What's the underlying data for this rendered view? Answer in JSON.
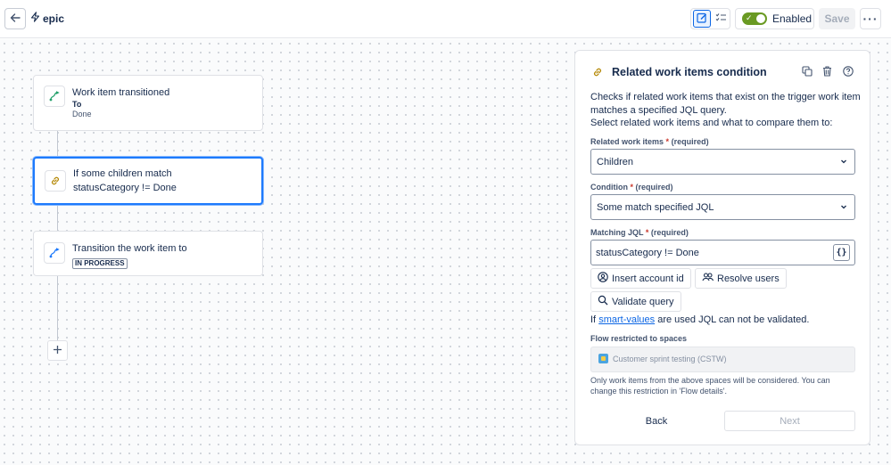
{
  "topbar": {
    "rule_name": "epic",
    "enabled_label": "Enabled",
    "enabled": true,
    "save_label": "Save"
  },
  "flow": {
    "trigger": {
      "title": "Work item transitioned",
      "sub_label": "To",
      "sub_value": "Done"
    },
    "condition": {
      "line1": "If some children match",
      "line2": "statusCategory != Done"
    },
    "action": {
      "title": "Transition the work item to",
      "status": "IN PROGRESS"
    }
  },
  "panel": {
    "title": "Related work items condition",
    "description_line1": "Checks if related work items that exist on the trigger work item matches a specified JQL query.",
    "description_line2": "Select related work items and what to compare them to:",
    "related_label": "Related work items",
    "related_required": "(required)",
    "related_value": "Children",
    "condition_label": "Condition",
    "condition_required": "(required)",
    "condition_value": "Some match specified JQL",
    "jql_label": "Matching JQL",
    "jql_required": "(required)",
    "jql_value": "statusCategory != Done",
    "braces_label": "{}",
    "insert_account_label": "Insert account id",
    "resolve_users_label": "Resolve users",
    "validate_query_label": "Validate query",
    "note_prefix": "If",
    "note_link": "smart-values",
    "note_suffix": "are used JQL can not be validated.",
    "spaces_label": "Flow restricted to spaces",
    "space_tag": "Customer sprint testing (CSTW)",
    "help_text": "Only work items from the above spaces will be considered. You can change this restriction in 'Flow details'.",
    "back_label": "Back",
    "next_label": "Next"
  },
  "colors": {
    "accent": "#0c66e4",
    "toggle_on": "#6a9a23",
    "selected_border": "#1d7afc",
    "required": "#c9372c"
  }
}
